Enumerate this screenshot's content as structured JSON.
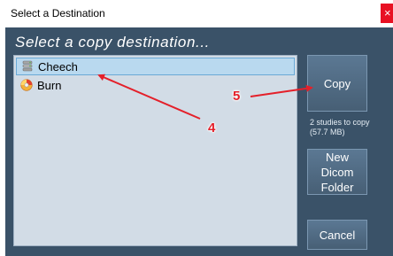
{
  "window": {
    "title": "Select a Destination",
    "close_glyph": "×"
  },
  "dialog": {
    "heading": "Select a copy destination...",
    "destinations": [
      {
        "label": "Cheech",
        "icon": "server-icon",
        "selected": true
      },
      {
        "label": "Burn",
        "icon": "disc-burn-icon",
        "selected": false
      }
    ],
    "buttons": {
      "copy": "Copy",
      "new_dicom_folder_line1": "New Dicom",
      "new_dicom_folder_line2": "Folder",
      "cancel": "Cancel"
    },
    "copy_info_line1": "2 studies to copy",
    "copy_info_line2": "(57.7 MB)"
  },
  "annotations": {
    "callout_4": "4",
    "callout_5": "5",
    "arrow_color": "#e4202a"
  },
  "colors": {
    "dialog_bg": "#3a5268",
    "list_bg": "#d2dce6",
    "selected_bg": "#b9d9ef",
    "button_bg": "#52708b",
    "close_bg": "#e81123"
  }
}
